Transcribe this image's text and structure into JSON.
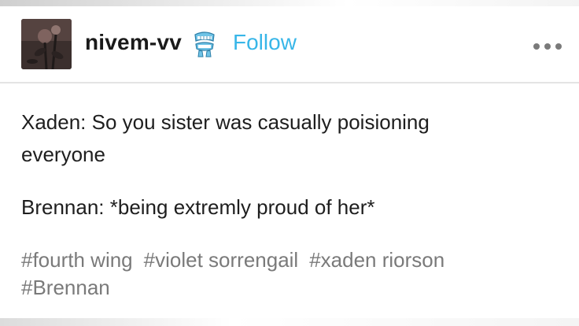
{
  "header": {
    "username": "nivem-vv",
    "follow_label": "Follow",
    "badge_icon": "teeth-sticker-icon",
    "more_icon": "more-options-icon"
  },
  "post": {
    "lines": [
      "Xaden: So you sister was casually poisioning",
      "everyone",
      "Brennan: *being extremly proud of her*"
    ]
  },
  "tags": [
    "#fourth wing",
    "#violet sorrengail",
    "#xaden riorson",
    "#Brennan"
  ],
  "colors": {
    "follow": "#38b6e8",
    "tag_text": "#7a7a7a",
    "body_text": "#1e1e1e"
  }
}
